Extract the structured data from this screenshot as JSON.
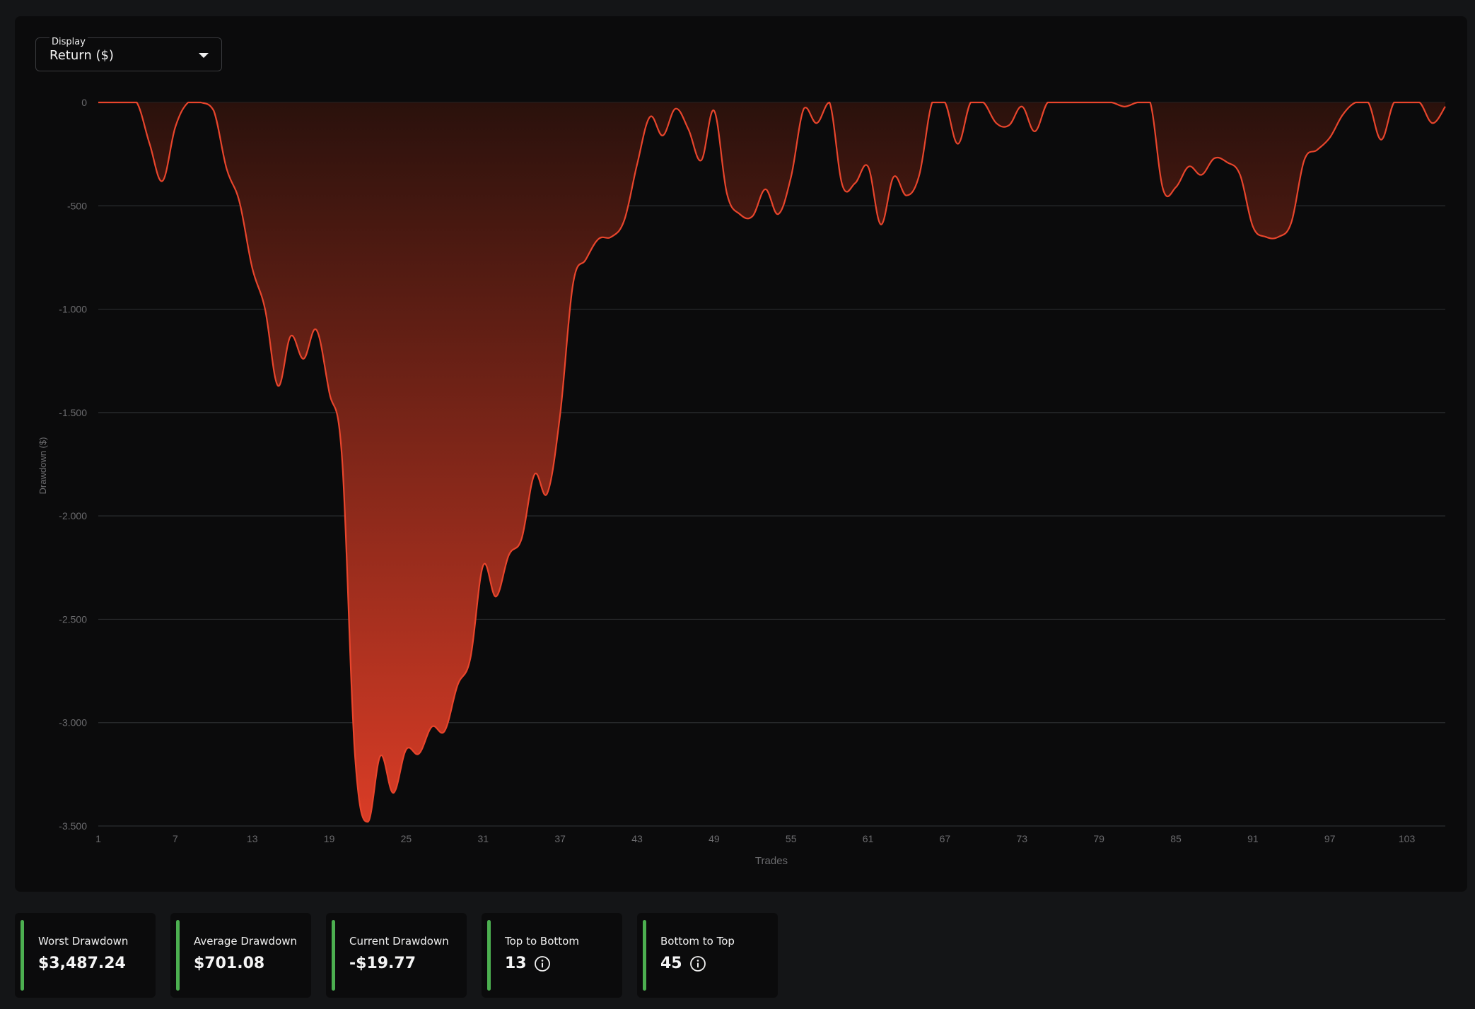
{
  "display_select": {
    "label": "Display",
    "value": "Return ($)"
  },
  "chart_data": {
    "type": "area",
    "title": "",
    "xlabel": "Trades",
    "ylabel": "Drawdown ($)",
    "ylim": [
      -3500,
      0
    ],
    "yticks": [
      0,
      -500,
      -1000,
      -1500,
      -2000,
      -2500,
      -3000,
      -3500
    ],
    "ytick_labels": [
      "0",
      "-500",
      "-1.000",
      "-1.500",
      "-2.000",
      "-2.500",
      "-3.000",
      "-3.500"
    ],
    "xlim": [
      1,
      106
    ],
    "xticks": [
      1,
      7,
      13,
      19,
      25,
      31,
      37,
      43,
      49,
      55,
      61,
      67,
      73,
      79,
      85,
      91,
      97,
      103
    ],
    "xtick_labels": [
      "1",
      "7",
      "13",
      "19",
      "25",
      "31",
      "37",
      "43",
      "49",
      "55",
      "61",
      "67",
      "73",
      "79",
      "85",
      "91",
      "97",
      "103"
    ],
    "grid": "horizontal",
    "colors": {
      "line": "#e8452c",
      "fill_top": "#2a110c",
      "fill_bottom": "#d93c26"
    },
    "series": [
      {
        "values": [
          0,
          0,
          0,
          0,
          -200,
          -380,
          -120,
          0,
          0,
          -40,
          -320,
          -480,
          -800,
          -1000,
          -1370,
          -1130,
          -1240,
          -1100,
          -1400,
          -1720,
          -3150,
          -3480,
          -3160,
          -3340,
          -3130,
          -3150,
          -3020,
          -3040,
          -2820,
          -2690,
          -2240,
          -2390,
          -2190,
          -2110,
          -1800,
          -1890,
          -1510,
          -880,
          -760,
          -660,
          -650,
          -570,
          -300,
          -70,
          -160,
          -30,
          -130,
          -280,
          -40,
          -440,
          -540,
          -550,
          -420,
          -540,
          -360,
          -30,
          -100,
          0,
          -400,
          -390,
          -310,
          -590,
          -360,
          -450,
          -350,
          0,
          0,
          -200,
          0,
          0,
          -100,
          -110,
          -20,
          -140,
          0,
          0,
          0,
          0,
          0,
          0,
          -20,
          0,
          0,
          -420,
          -410,
          -310,
          -350,
          -270,
          -290,
          -350,
          -600,
          -650,
          -650,
          -580,
          -280,
          -230,
          -170,
          -60,
          0,
          0,
          -180,
          0,
          0,
          0,
          -100,
          -20
        ]
      }
    ]
  },
  "stats": [
    {
      "label": "Worst Drawdown",
      "value": "$3,487.24",
      "info": false
    },
    {
      "label": "Average Drawdown",
      "value": "$701.08",
      "info": false
    },
    {
      "label": "Current Drawdown",
      "value": "-$19.77",
      "info": false
    },
    {
      "label": "Top to Bottom",
      "value": "13",
      "info": true,
      "icon": "info-icon"
    },
    {
      "label": "Bottom to Top",
      "value": "45",
      "info": true,
      "icon": "info-icon"
    }
  ]
}
